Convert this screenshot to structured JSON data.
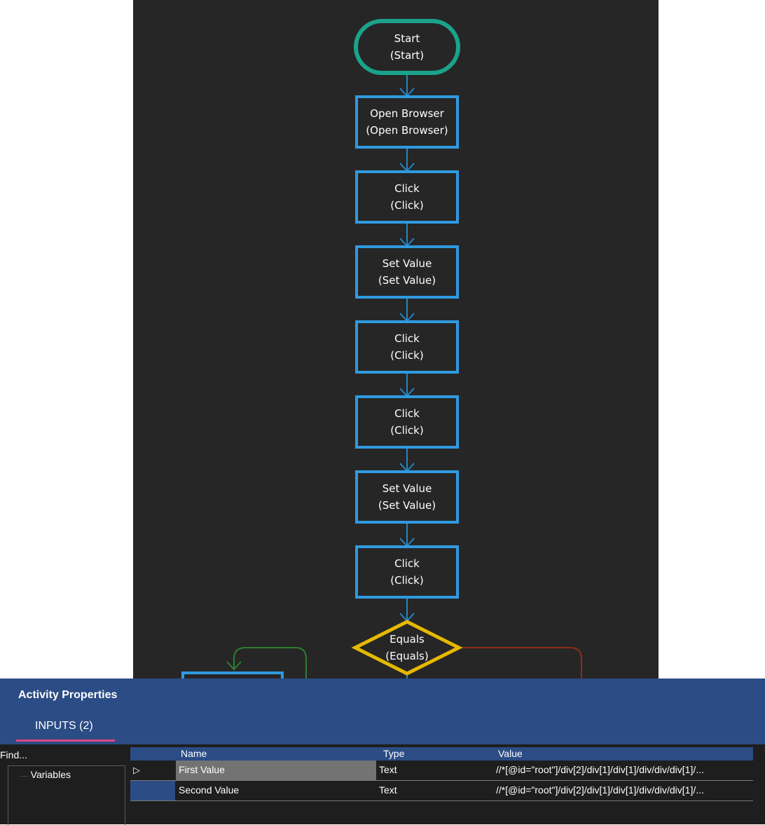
{
  "flowchart": {
    "nodes": [
      {
        "id": "start",
        "shape": "terminal",
        "title": "Start",
        "subtitle": "(Start)",
        "color": "#1aa38a"
      },
      {
        "id": "open-browser",
        "shape": "process",
        "title": "Open Browser",
        "subtitle": "(Open Browser)",
        "color": "#2f9ae0"
      },
      {
        "id": "click-1",
        "shape": "process",
        "title": "Click",
        "subtitle": "(Click)",
        "color": "#2f9ae0"
      },
      {
        "id": "set-value-1",
        "shape": "process",
        "title": "Set Value",
        "subtitle": "(Set Value)",
        "color": "#2f9ae0"
      },
      {
        "id": "click-2",
        "shape": "process",
        "title": "Click",
        "subtitle": "(Click)",
        "color": "#2f9ae0"
      },
      {
        "id": "click-3",
        "shape": "process",
        "title": "Click",
        "subtitle": "(Click)",
        "color": "#2f9ae0"
      },
      {
        "id": "set-value-2",
        "shape": "process",
        "title": "Set Value",
        "subtitle": "(Set Value)",
        "color": "#2f9ae0"
      },
      {
        "id": "click-4",
        "shape": "process",
        "title": "Click",
        "subtitle": "(Click)",
        "color": "#2f9ae0"
      },
      {
        "id": "equals",
        "shape": "decision",
        "title": "Equals",
        "subtitle": "(Equals)",
        "color": "#e6b800"
      }
    ],
    "connector_color": "#2585c4",
    "true_branch_color": "#2e7d32",
    "false_branch_color": "#8b2e17"
  },
  "properties": {
    "title": "Activity Properties",
    "tab_label": "INPUTS (2)",
    "tab_accent": "#e2447f",
    "find_placeholder": "Find...",
    "tree_item": "Variables",
    "columns": {
      "name": "Name",
      "type": "Type",
      "value": "Value"
    },
    "rows": [
      {
        "name": "First Value",
        "type": "Text",
        "value": "//*[@id=\"root\"]/div[2]/div[1]/div[1]/div/div/div[1]/...",
        "selected": true
      },
      {
        "name": "Second Value",
        "type": "Text",
        "value": "//*[@id=\"root\"]/div[2]/div[1]/div[1]/div/div/div[1]/...",
        "selected": false
      }
    ]
  }
}
